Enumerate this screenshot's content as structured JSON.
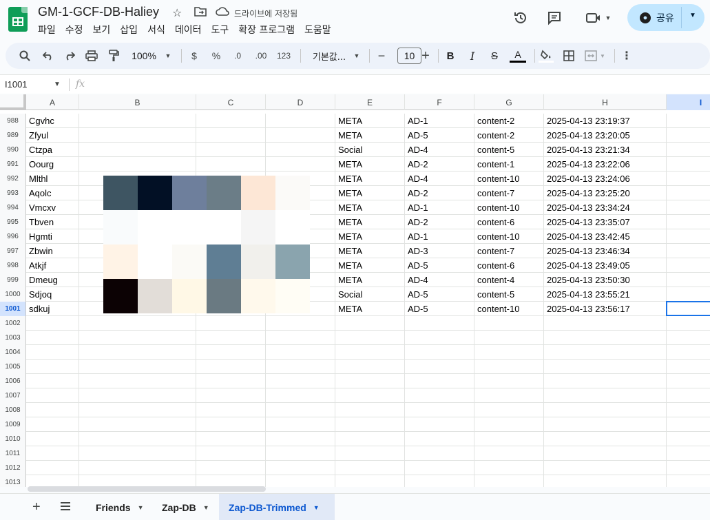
{
  "doc": {
    "title": "GM-1-GCF-DB-Haliey",
    "saved_status": "드라이브에 저장됨"
  },
  "menu": [
    "파일",
    "수정",
    "보기",
    "삽입",
    "서식",
    "데이터",
    "도구",
    "확장 프로그램",
    "도움말"
  ],
  "share": {
    "label": "공유"
  },
  "toolbar": {
    "zoom": "100%",
    "currency": "$",
    "percent": "%",
    "decimal_decrease": ".0",
    "decimal_increase": ".00",
    "number_format": "123",
    "font": "기본값...",
    "font_size": "10",
    "minus": "−",
    "plus": "+"
  },
  "formula": {
    "name_box": "I1001",
    "fx": "fx",
    "value": ""
  },
  "columns": [
    "A",
    "B",
    "C",
    "D",
    "E",
    "F",
    "G",
    "H",
    "I"
  ],
  "selected_column": "I",
  "rows": [
    {
      "n": "988",
      "a": "Cgvhc",
      "e": "META",
      "f": "AD-1",
      "g": "content-2",
      "h": "2025-04-13 23:19:37"
    },
    {
      "n": "989",
      "a": "Zfyul",
      "e": "META",
      "f": "AD-5",
      "g": "content-2",
      "h": "2025-04-13 23:20:05"
    },
    {
      "n": "990",
      "a": "Ctzpa",
      "e": "Social",
      "f": "AD-4",
      "g": "content-5",
      "h": "2025-04-13 23:21:34"
    },
    {
      "n": "991",
      "a": "Oourg",
      "e": "META",
      "f": "AD-2",
      "g": "content-1",
      "h": "2025-04-13 23:22:06"
    },
    {
      "n": "992",
      "a": "Mlthl",
      "e": "META",
      "f": "AD-4",
      "g": "content-10",
      "h": "2025-04-13 23:24:06"
    },
    {
      "n": "993",
      "a": "Aqolc",
      "e": "META",
      "f": "AD-2",
      "g": "content-7",
      "h": "2025-04-13 23:25:20"
    },
    {
      "n": "994",
      "a": "Vmcxv",
      "e": "META",
      "f": "AD-1",
      "g": "content-10",
      "h": "2025-04-13 23:34:24"
    },
    {
      "n": "995",
      "a": "Tbven",
      "e": "META",
      "f": "AD-2",
      "g": "content-6",
      "h": "2025-04-13 23:35:07"
    },
    {
      "n": "996",
      "a": "Hgmti",
      "e": "META",
      "f": "AD-1",
      "g": "content-10",
      "h": "2025-04-13 23:42:45"
    },
    {
      "n": "997",
      "a": "Zbwin",
      "e": "META",
      "f": "AD-3",
      "g": "content-7",
      "h": "2025-04-13 23:46:34"
    },
    {
      "n": "998",
      "a": "Atkjf",
      "e": "META",
      "f": "AD-5",
      "g": "content-6",
      "h": "2025-04-13 23:49:05"
    },
    {
      "n": "999",
      "a": "Dmeug",
      "e": "META",
      "f": "AD-4",
      "g": "content-4",
      "h": "2025-04-13 23:50:30"
    },
    {
      "n": "1000",
      "a": "Sdjoq",
      "e": "Social",
      "f": "AD-5",
      "g": "content-5",
      "h": "2025-04-13 23:55:21"
    },
    {
      "n": "1001",
      "a": "sdkuj",
      "e": "META",
      "f": "AD-5",
      "g": "content-10",
      "h": "2025-04-13 23:56:17"
    },
    {
      "n": "1002"
    },
    {
      "n": "1003"
    },
    {
      "n": "1004"
    },
    {
      "n": "1005"
    },
    {
      "n": "1006"
    },
    {
      "n": "1007"
    },
    {
      "n": "1008"
    },
    {
      "n": "1009"
    },
    {
      "n": "1010"
    },
    {
      "n": "1011"
    },
    {
      "n": "1012"
    },
    {
      "n": "1013"
    }
  ],
  "selected_row": "1001",
  "sheets": [
    {
      "name": "Friends",
      "active": false
    },
    {
      "name": "Zap-DB",
      "active": false
    },
    {
      "name": "Zap-DB-Trimmed",
      "active": true
    }
  ],
  "blur_colors": [
    [
      "#3e5562",
      "#021025",
      "#6e7f9c",
      "#6b7d87",
      "#fde7d6",
      "#fbfaf8"
    ],
    [
      "#f9fbfc",
      "#ffffff",
      "#ffffff",
      "#ffffff",
      "#f5f5f5",
      "#ffffff"
    ],
    [
      "#fff3e6",
      "#ffffff",
      "#fbfaf6",
      "#5f7e94",
      "#f1f0ec",
      "#8aa4ae"
    ],
    [
      "#0c0204",
      "#e2ddd8",
      "#fff8e6",
      "#6a7a82",
      "#fff9ec",
      "#fffdf5"
    ]
  ]
}
